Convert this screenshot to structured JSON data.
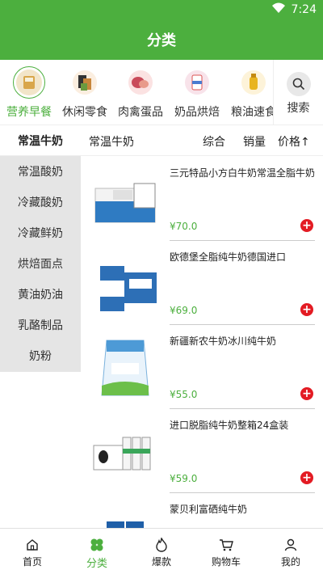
{
  "status": {
    "time": "7:24"
  },
  "header": {
    "title": "分类"
  },
  "categories": [
    {
      "label": "营养早餐",
      "selected": true,
      "icon": "breakfast-icon"
    },
    {
      "label": "休闲零食",
      "selected": false,
      "icon": "snack-icon"
    },
    {
      "label": "肉禽蛋品",
      "selected": false,
      "icon": "meat-icon"
    },
    {
      "label": "奶品烘焙",
      "selected": false,
      "icon": "dairy-icon"
    },
    {
      "label": "粮油速食",
      "selected": false,
      "icon": "grain-icon"
    }
  ],
  "search": {
    "label": "搜索"
  },
  "filter": {
    "side_title": "常温牛奶",
    "current": "常温牛奶",
    "options": [
      "综合",
      "销量",
      "价格↑"
    ]
  },
  "sidebar": {
    "items": [
      "常温酸奶",
      "冷藏酸奶",
      "冷藏鲜奶",
      "烘焙面点",
      "黄油奶油",
      "乳酪制品",
      "奶粉"
    ]
  },
  "products": [
    {
      "name": "三元特品小方白牛奶常温全脂牛奶",
      "price": "¥70.0"
    },
    {
      "name": "欧德堡全脂纯牛奶德国进口",
      "price": "¥69.0"
    },
    {
      "name": "新疆新农牛奶冰川纯牛奶",
      "price": "¥55.0"
    },
    {
      "name": "进口脱脂纯牛奶整箱24盒装",
      "price": "¥59.0"
    },
    {
      "name": "蒙贝利富硒纯牛奶",
      "price": ""
    }
  ],
  "tabbar": [
    {
      "label": "首页",
      "icon": "home-icon",
      "selected": false
    },
    {
      "label": "分类",
      "icon": "category-icon",
      "selected": true
    },
    {
      "label": "爆款",
      "icon": "fire-icon",
      "selected": false
    },
    {
      "label": "购物车",
      "icon": "cart-icon",
      "selected": false
    },
    {
      "label": "我的",
      "icon": "user-icon",
      "selected": false
    }
  ],
  "colors": {
    "primary": "#4caf3e",
    "add": "#e31b23",
    "sidebar_bg": "#e5e5e5"
  }
}
